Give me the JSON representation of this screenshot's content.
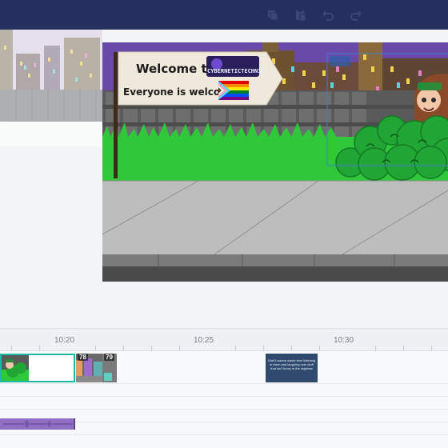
{
  "toolbar": {
    "buttons": [
      {
        "name": "copy-icon"
      },
      {
        "name": "paste-icon"
      },
      {
        "name": "undo-icon"
      },
      {
        "name": "redo-icon"
      }
    ],
    "colors": {
      "background": "#26305e",
      "icon": "#3b4776"
    }
  },
  "stage": {
    "sign": {
      "line1": "Welcome to",
      "line2": "Everyone is welcome",
      "logo_text": "CYBERNETICTECHNIC"
    },
    "colors": {
      "sky": "#6a4aa8",
      "grass": "#2ec83a",
      "fence": "#5a5a5a",
      "sidewalk": "#bdbdbd",
      "curb": "#6c6c6c",
      "sign": "#efe9dc"
    }
  },
  "timeline": {
    "ruler_labels": [
      "10:20",
      "10:25",
      "10:30"
    ],
    "clips": [
      {
        "number": "78"
      },
      {
        "number": "79"
      },
      {
        "text": "Didn't wanna waste time listening to them and laughing over stuff that isn't funny in the slightest"
      }
    ],
    "colors": {
      "selected_border": "#1fb7a6",
      "audio": "#8e6fc4"
    }
  }
}
